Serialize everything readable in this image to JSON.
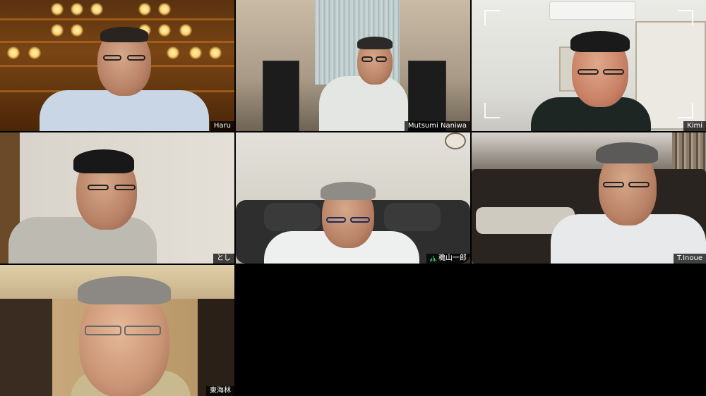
{
  "meeting": {
    "participants": [
      {
        "name": "Haru"
      },
      {
        "name": "Mutsumi Naniwa"
      },
      {
        "name": "Kimi"
      },
      {
        "name": "とし"
      },
      {
        "name": "穐山一郎",
        "active_speaker": true,
        "mic_icon": "audio-level-icon"
      },
      {
        "name": "T.Inoue"
      },
      {
        "name": "東海林"
      }
    ]
  },
  "colors": {
    "background": "#000000",
    "active_speaker_border": "#23d160",
    "name_tag_bg": "rgba(0,0,0,0.72)",
    "name_tag_text": "#ffffff"
  }
}
